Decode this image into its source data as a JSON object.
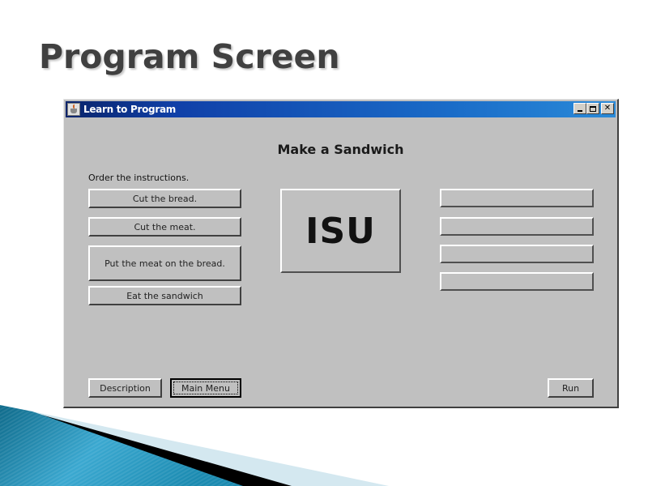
{
  "slide": {
    "title": "Program Screen"
  },
  "window": {
    "title": "Learn to Program",
    "controls": {
      "minimize_icon": "minimize-icon",
      "maximize_icon": "maximize-icon",
      "close_icon": "close-icon",
      "close_glyph": "✕"
    }
  },
  "main": {
    "heading": "Make a Sandwich",
    "instructions_label": "Order the instructions.",
    "instructions": [
      {
        "label": "Cut the bread."
      },
      {
        "label": "Cut the meat."
      },
      {
        "label": "Put the meat on the bread."
      },
      {
        "label": "Eat the sandwich"
      }
    ],
    "logo_text": "ISU",
    "answer_slots": [
      {
        "value": ""
      },
      {
        "value": ""
      },
      {
        "value": ""
      },
      {
        "value": ""
      }
    ]
  },
  "footer": {
    "description_label": "Description",
    "main_menu_label": "Main Menu",
    "run_label": "Run"
  },
  "colors": {
    "titlebar_start": "#0a246a",
    "titlebar_end": "#2a8ad8",
    "window_bg": "#c0c0c0",
    "slide_title": "#404040",
    "decor_teal": "#1a8ab0"
  }
}
